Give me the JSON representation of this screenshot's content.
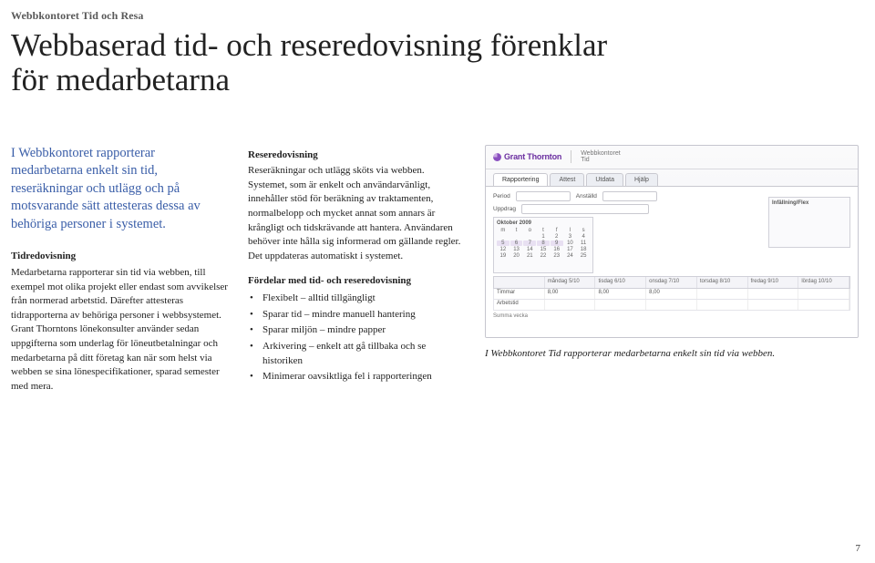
{
  "kicker": "Webbkontoret Tid och Resa",
  "headline_l1": "Webbaserad tid- och reseredovisning förenklar",
  "headline_l2": "för medarbetarna",
  "intro": "I Webbkontoret rapporterar medarbetarna enkelt sin tid, reseräkningar och utlägg och på motsvarande sätt attesteras dessa av behöriga personer i systemet.",
  "col1": {
    "subhead": "Tidredovisning",
    "body": "Medarbetarna rapporterar sin tid via webben, till exempel mot olika projekt eller endast som avvikelser från normerad arbetstid. Därefter attesteras tidrapporterna av behöriga personer i webbsystemet. Grant Thorntons lönekonsulter använder sedan uppgifterna som underlag för löneutbetalningar och medarbetarna på ditt företag kan när som helst via webben se sina lönespecifikationer, sparad semester med mera."
  },
  "col2": {
    "subhead1": "Reseredovisning",
    "body1": "Reseräkningar och utlägg sköts via webben. Systemet, som är enkelt och användarvänligt, innehåller stöd för beräkning av traktamenten, normalbelopp och mycket annat som annars är krångligt och tidskrävande att hantera. Användaren behöver inte hålla sig informerad om gällande regler. Det uppdateras automatiskt i systemet.",
    "benefits_head": "Fördelar med tid- och reseredovisning",
    "benefits": [
      "Flexibelt – alltid tillgängligt",
      "Sparar tid – mindre manuell hantering",
      "Sparar miljön – mindre papper",
      "Arkivering – enkelt att gå tillbaka och se historiken",
      "Minimerar oavsiktliga fel i rapporteringen"
    ]
  },
  "screenshot": {
    "brand": "Grant Thornton",
    "module_l1": "Webbkontoret",
    "module_l2": "Tid",
    "tabs": [
      "Rapportering",
      "Attest",
      "Utdata",
      "Hjälp"
    ],
    "active_tab": 0,
    "filters": {
      "label_period": "Period",
      "label_anstalld": "Anställd",
      "label_uppdrag": "Uppdrag"
    },
    "cal_month": "Oktober 2009",
    "sidebox_title": "Infällning/Flex",
    "grid_head": [
      "",
      "måndag 5/10",
      "tisdag 6/10",
      "onsdag 7/10",
      "torsdag 8/10",
      "fredag 9/10",
      "lördag 10/10"
    ],
    "grid_rows": [
      [
        "Timmar",
        "8,00",
        "8,00",
        "8,00",
        "",
        "",
        ""
      ],
      [
        "Arbetstid",
        "",
        "",
        "",
        "",
        "",
        ""
      ]
    ],
    "footer_label": "Summa vecka"
  },
  "caption": "I Webbkontoret Tid rapporterar medarbetarna enkelt sin tid via webben.",
  "page_number": "7"
}
